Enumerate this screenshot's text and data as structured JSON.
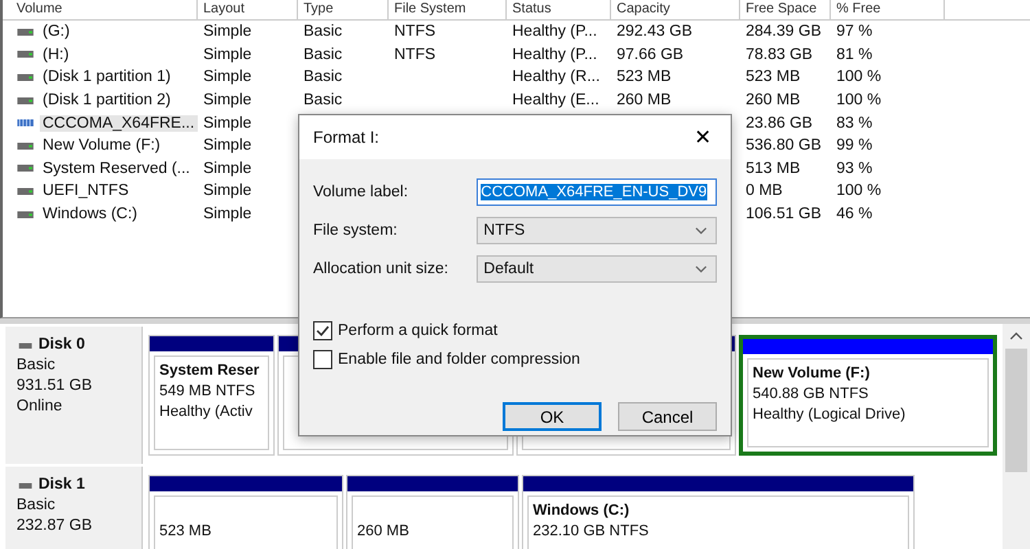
{
  "volume_list": {
    "columns": [
      "Volume",
      "Layout",
      "Type",
      "File System",
      "Status",
      "Capacity",
      "Free Space",
      "% Free"
    ],
    "rows": [
      {
        "kind": "drive",
        "selected": false,
        "cells": [
          "(G:)",
          "Simple",
          "Basic",
          "NTFS",
          "Healthy (P...",
          "292.43 GB",
          "284.39 GB",
          "97 %"
        ]
      },
      {
        "kind": "drive",
        "selected": false,
        "cells": [
          "(H:)",
          "Simple",
          "Basic",
          "NTFS",
          "Healthy (P...",
          "97.66 GB",
          "78.83 GB",
          "81 %"
        ]
      },
      {
        "kind": "drive",
        "selected": false,
        "cells": [
          "(Disk 1 partition 1)",
          "Simple",
          "Basic",
          "",
          "Healthy (R...",
          "523 MB",
          "523 MB",
          "100 %"
        ]
      },
      {
        "kind": "drive",
        "selected": false,
        "cells": [
          "(Disk 1 partition 2)",
          "Simple",
          "Basic",
          "",
          "Healthy (E...",
          "260 MB",
          "260 MB",
          "100 %"
        ]
      },
      {
        "kind": "usb",
        "selected": true,
        "cells": [
          "CCCOMA_X64FRE...",
          "Simple",
          "",
          "",
          "",
          "",
          "23.86 GB",
          "83 %"
        ]
      },
      {
        "kind": "drive",
        "selected": false,
        "cells": [
          "New Volume (F:)",
          "Simple",
          "",
          "",
          "",
          "",
          "536.80 GB",
          "99 %"
        ]
      },
      {
        "kind": "drive",
        "selected": false,
        "cells": [
          "System Reserved (...",
          "Simple",
          "",
          "",
          "",
          "",
          "513 MB",
          "93 %"
        ]
      },
      {
        "kind": "drive",
        "selected": false,
        "cells": [
          "UEFI_NTFS",
          "Simple",
          "",
          "",
          "",
          "",
          "0 MB",
          "100 %"
        ]
      },
      {
        "kind": "drive",
        "selected": false,
        "cells": [
          "Windows (C:)",
          "Simple",
          "",
          "",
          "",
          "",
          "106.51 GB",
          "46 %"
        ]
      }
    ]
  },
  "disks": [
    {
      "name": "Disk 0",
      "lines": [
        "Basic",
        "931.51 GB",
        "Online"
      ],
      "partitions": [
        {
          "kind": "primary",
          "selected": false,
          "title": "System Reser",
          "lines": [
            "549 MB NTFS",
            "Healthy (Activ"
          ]
        },
        {
          "kind": "primary",
          "selected": false
        },
        {
          "kind": "primary",
          "selected": false
        },
        {
          "kind": "logical",
          "selected": true,
          "title": "New Volume  (F:)",
          "lines": [
            "540.88 GB NTFS",
            "Healthy (Logical Drive)"
          ]
        }
      ]
    },
    {
      "name": "Disk 1",
      "lines": [
        "Basic",
        "232.87 GB"
      ],
      "partitions": [
        {
          "kind": "primary",
          "selected": false,
          "lines": [
            "523 MB"
          ]
        },
        {
          "kind": "primary",
          "selected": false,
          "lines": [
            "260 MB"
          ]
        },
        {
          "kind": "primary",
          "selected": false,
          "title": "Windows  (C:)",
          "lines": [
            "232.10 GB NTFS"
          ]
        }
      ]
    }
  ],
  "dialog": {
    "title": "Format I:",
    "close": "✕",
    "fields": [
      {
        "kind": "text",
        "label": "Volume label:",
        "value": "CCCOMA_X64FRE_EN-US_DV9"
      },
      {
        "kind": "select",
        "label": "File system:",
        "value": "NTFS"
      },
      {
        "kind": "select",
        "label": "Allocation unit size:",
        "value": "Default"
      }
    ],
    "options": [
      {
        "label": "Perform a quick format",
        "checked": true
      },
      {
        "label": "Enable file and folder compression",
        "checked": false
      }
    ],
    "buttons": [
      {
        "label": "OK",
        "selected": true
      },
      {
        "label": "Cancel",
        "selected": false
      }
    ]
  }
}
